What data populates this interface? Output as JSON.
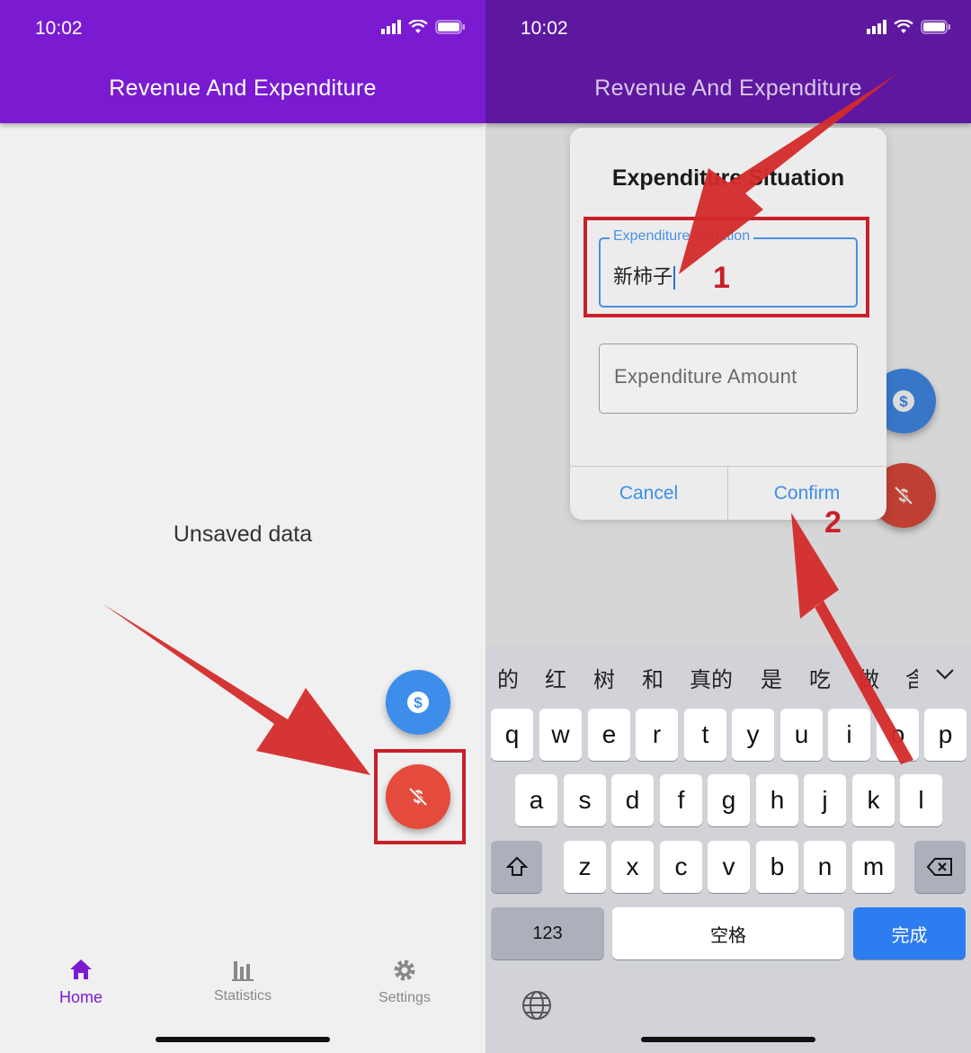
{
  "left_screen": {
    "status": {
      "time": "10:02"
    },
    "appbar": {
      "title": "Revenue And Expenditure"
    },
    "empty_text": "Unsaved data",
    "fab_income": {
      "icon": "dollar-circle-icon"
    },
    "fab_expense": {
      "icon": "dollar-off-icon"
    },
    "bottom_nav": [
      {
        "label": "Home",
        "icon": "home-icon",
        "active": true
      },
      {
        "label": "Statistics",
        "icon": "bar-chart-icon",
        "active": false
      },
      {
        "label": "Settings",
        "icon": "gear-icon",
        "active": false
      }
    ]
  },
  "right_screen": {
    "status": {
      "time": "10:02"
    },
    "appbar": {
      "title": "Revenue And Expenditure"
    },
    "dialog": {
      "title": "Expenditure Situation",
      "field1_label": "Expenditure Situation",
      "field1_value": "新柿子",
      "field2_placeholder": "Expenditure Amount",
      "cancel": "Cancel",
      "confirm": "Confirm"
    },
    "keyboard": {
      "candidates": [
        "的",
        "红",
        "树",
        "和",
        "真的",
        "是",
        "吃",
        "做",
        "含"
      ],
      "row1": [
        "q",
        "w",
        "e",
        "r",
        "t",
        "y",
        "u",
        "i",
        "o",
        "p"
      ],
      "row2": [
        "a",
        "s",
        "d",
        "f",
        "g",
        "h",
        "j",
        "k",
        "l"
      ],
      "row3": [
        "z",
        "x",
        "c",
        "v",
        "b",
        "n",
        "m"
      ],
      "numbers_key": "123",
      "space_key": "空格",
      "done_key": "完成"
    },
    "annotations": [
      "1",
      "2"
    ]
  },
  "colors": {
    "appbar": "#7a1bd2",
    "fab_blue": "#3d8eea",
    "fab_red": "#e54b3c",
    "annotation_red": "#c8202a"
  }
}
